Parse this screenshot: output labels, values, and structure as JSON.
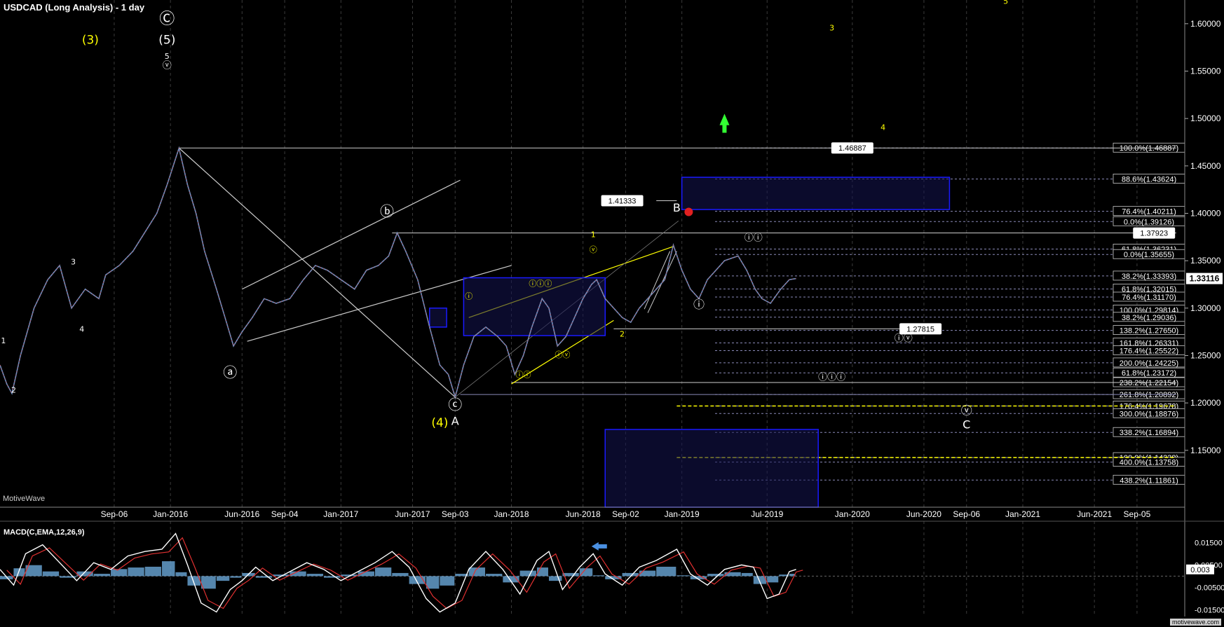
{
  "title": "USDCAD (Long  Analysis) - 1 day",
  "macd_title": "MACD(C,EMA,12,26,9)",
  "brand": "MotiveWave",
  "watermark": "motivewave.com",
  "colors": {
    "background": "#000000",
    "grid": "#3a3a3a",
    "axis": "#ffffff",
    "yellow": "#ffff00",
    "blue": "#1a1aff",
    "fib": "#8a8ab8",
    "macd_hist": "#6aa8d8",
    "macd_line": "#ffffff",
    "signal_line": "#e03030",
    "green": "#33ff33"
  },
  "chart_data": {
    "type": "line",
    "symbol": "USDCAD",
    "timeframe": "1 day",
    "x_axis": {
      "ticks": [
        "Sep-06",
        "Jan-2016",
        "Jun-2016",
        "Sep-04",
        "Jan-2017",
        "Jun-2017",
        "Sep-03",
        "Jan-2018",
        "Jun-2018",
        "Sep-02",
        "Jan-2019",
        "Jul-2019",
        "Jan-2020",
        "Jun-2020",
        "Sep-06",
        "Jan-2021",
        "Jun-2021",
        "Sep-05"
      ],
      "tick_pos": [
        2015.67,
        2016.0,
        2016.42,
        2016.67,
        2017.0,
        2017.42,
        2017.67,
        2018.0,
        2018.42,
        2018.67,
        2019.0,
        2019.5,
        2020.0,
        2020.42,
        2020.67,
        2021.0,
        2021.42,
        2021.67
      ],
      "xlim": [
        2015.0,
        2021.95
      ]
    },
    "y_axis": {
      "ticks": [
        "1.60000",
        "1.55000",
        "1.50000",
        "1.45000",
        "1.40000",
        "1.35000",
        "1.30000",
        "1.25000",
        "1.20000",
        "1.15000"
      ],
      "ylim": [
        1.09,
        1.625
      ]
    },
    "price_series": [
      [
        2015.0,
        1.24
      ],
      [
        2015.04,
        1.22
      ],
      [
        2015.07,
        1.21
      ],
      [
        2015.12,
        1.25
      ],
      [
        2015.2,
        1.3
      ],
      [
        2015.28,
        1.33
      ],
      [
        2015.35,
        1.345
      ],
      [
        2015.42,
        1.3
      ],
      [
        2015.5,
        1.32
      ],
      [
        2015.58,
        1.31
      ],
      [
        2015.62,
        1.335
      ],
      [
        2015.7,
        1.345
      ],
      [
        2015.78,
        1.36
      ],
      [
        2015.85,
        1.38
      ],
      [
        2015.92,
        1.4
      ],
      [
        2015.98,
        1.43
      ],
      [
        2016.05,
        1.4687
      ],
      [
        2016.1,
        1.43
      ],
      [
        2016.15,
        1.4
      ],
      [
        2016.2,
        1.36
      ],
      [
        2016.27,
        1.32
      ],
      [
        2016.32,
        1.29
      ],
      [
        2016.37,
        1.26
      ],
      [
        2016.42,
        1.275
      ],
      [
        2016.48,
        1.29
      ],
      [
        2016.55,
        1.31
      ],
      [
        2016.62,
        1.305
      ],
      [
        2016.7,
        1.31
      ],
      [
        2016.78,
        1.33
      ],
      [
        2016.85,
        1.345
      ],
      [
        2016.92,
        1.34
      ],
      [
        2017.0,
        1.33
      ],
      [
        2017.08,
        1.32
      ],
      [
        2017.15,
        1.34
      ],
      [
        2017.22,
        1.345
      ],
      [
        2017.28,
        1.355
      ],
      [
        2017.33,
        1.3793
      ],
      [
        2017.38,
        1.36
      ],
      [
        2017.45,
        1.33
      ],
      [
        2017.52,
        1.28
      ],
      [
        2017.58,
        1.24
      ],
      [
        2017.63,
        1.23
      ],
      [
        2017.67,
        1.2061
      ],
      [
        2017.72,
        1.24
      ],
      [
        2017.78,
        1.27
      ],
      [
        2017.85,
        1.28
      ],
      [
        2017.92,
        1.27
      ],
      [
        2017.97,
        1.26
      ],
      [
        2018.02,
        1.23
      ],
      [
        2018.07,
        1.25
      ],
      [
        2018.12,
        1.28
      ],
      [
        2018.18,
        1.31
      ],
      [
        2018.22,
        1.3
      ],
      [
        2018.27,
        1.26
      ],
      [
        2018.32,
        1.27
      ],
      [
        2018.37,
        1.29
      ],
      [
        2018.42,
        1.31
      ],
      [
        2018.47,
        1.325
      ],
      [
        2018.5,
        1.33
      ],
      [
        2018.55,
        1.31
      ],
      [
        2018.6,
        1.3
      ],
      [
        2018.65,
        1.29
      ],
      [
        2018.7,
        1.285
      ],
      [
        2018.75,
        1.3
      ],
      [
        2018.8,
        1.31
      ],
      [
        2018.85,
        1.32
      ],
      [
        2018.9,
        1.33
      ],
      [
        2018.95,
        1.3665
      ],
      [
        2019.0,
        1.34
      ],
      [
        2019.05,
        1.32
      ],
      [
        2019.1,
        1.31
      ],
      [
        2019.15,
        1.33
      ],
      [
        2019.2,
        1.34
      ],
      [
        2019.25,
        1.35
      ],
      [
        2019.33,
        1.355
      ],
      [
        2019.38,
        1.34
      ],
      [
        2019.43,
        1.32
      ],
      [
        2019.47,
        1.31
      ],
      [
        2019.52,
        1.305
      ],
      [
        2019.58,
        1.32
      ],
      [
        2019.63,
        1.33
      ],
      [
        2019.67,
        1.3312
      ]
    ],
    "annotations": [
      {
        "text": "(3)",
        "x": 2015.53,
        "y": 1.579,
        "color": "yellow",
        "size": 17
      },
      {
        "text": "Ⓒ",
        "x": 2015.98,
        "y": 1.6,
        "color": "white",
        "size": 22
      },
      {
        "text": "(5)",
        "x": 2015.98,
        "y": 1.579,
        "color": "white",
        "size": 17
      },
      {
        "text": "5",
        "x": 2015.98,
        "y": 1.563,
        "color": "white",
        "size": 11
      },
      {
        "text": "ⓥ",
        "x": 2015.98,
        "y": 1.553,
        "color": "white",
        "size": 13
      },
      {
        "text": "3",
        "x": 2015.43,
        "y": 1.346,
        "color": "white",
        "size": 11
      },
      {
        "text": "4",
        "x": 2015.48,
        "y": 1.275,
        "color": "white",
        "size": 11
      },
      {
        "text": "2",
        "x": 2015.08,
        "y": 1.211,
        "color": "white",
        "size": 11
      },
      {
        "text": "1",
        "x": 2015.02,
        "y": 1.263,
        "color": "white",
        "size": 11
      },
      {
        "text": "ⓐ",
        "x": 2016.35,
        "y": 1.227,
        "color": "white",
        "size": 20
      },
      {
        "text": "ⓑ",
        "x": 2017.27,
        "y": 1.397,
        "color": "white",
        "size": 20
      },
      {
        "text": "ⓒ",
        "x": 2017.67,
        "y": 1.193,
        "color": "white",
        "size": 20
      },
      {
        "text": "A",
        "x": 2017.67,
        "y": 1.177,
        "color": "white",
        "size": 16
      },
      {
        "text": "(4)",
        "x": 2017.58,
        "y": 1.175,
        "color": "yellow",
        "size": 17
      },
      {
        "text": "B",
        "x": 2018.97,
        "y": 1.402,
        "color": "white",
        "size": 16
      },
      {
        "text": "1",
        "x": 2018.48,
        "y": 1.375,
        "color": "yellow",
        "size": 11
      },
      {
        "text": "2",
        "x": 2018.65,
        "y": 1.27,
        "color": "yellow",
        "size": 11
      },
      {
        "text": "3",
        "x": 2019.88,
        "y": 1.593,
        "color": "yellow",
        "size": 11
      },
      {
        "text": "4",
        "x": 2020.18,
        "y": 1.488,
        "color": "yellow",
        "size": 11
      },
      {
        "text": "5",
        "x": 2020.9,
        "y": 1.621,
        "color": "yellow",
        "size": 11
      },
      {
        "text": "ⓘ",
        "x": 2019.1,
        "y": 1.3,
        "color": "white",
        "size": 16
      },
      {
        "text": "ⓘⓘ",
        "x": 2019.42,
        "y": 1.371,
        "color": "white",
        "size": 13
      },
      {
        "text": "ⓘⓘⓘ",
        "x": 2019.88,
        "y": 1.224,
        "color": "white",
        "size": 13
      },
      {
        "text": "ⓘⓥ",
        "x": 2020.3,
        "y": 1.265,
        "color": "white",
        "size": 13
      },
      {
        "text": "ⓥ",
        "x": 2020.67,
        "y": 1.188,
        "color": "white",
        "size": 16
      },
      {
        "text": "C",
        "x": 2020.67,
        "y": 1.173,
        "color": "white",
        "size": 16
      },
      {
        "text": "ⓘ",
        "x": 2017.75,
        "y": 1.31,
        "color": "yellow",
        "size": 11
      },
      {
        "text": "ⓘⓘ",
        "x": 2018.07,
        "y": 1.227,
        "color": "yellow",
        "size": 11
      },
      {
        "text": "ⓘⓘⓘ",
        "x": 2018.17,
        "y": 1.323,
        "color": "yellow",
        "size": 11
      },
      {
        "text": "ⓘⓥ",
        "x": 2018.3,
        "y": 1.248,
        "color": "yellow",
        "size": 11
      },
      {
        "text": "ⓥ",
        "x": 2018.48,
        "y": 1.359,
        "color": "yellow",
        "size": 11
      }
    ],
    "price_labels": [
      {
        "text": "1.46887",
        "x": 2020.0,
        "y": 1.4689
      },
      {
        "text": "1.41333",
        "x": 2018.65,
        "y": 1.4133
      },
      {
        "text": "1.37923",
        "x": 2021.77,
        "y": 1.3792
      },
      {
        "text": "1.27815",
        "x": 2020.4,
        "y": 1.2782
      }
    ],
    "current_price": "1.33116",
    "current_price_value": 1.3312,
    "fib_levels": [
      {
        "label": "100.0%(1.46887)",
        "value": 1.4689
      },
      {
        "label": "88.6%(1.43624)",
        "value": 1.4362
      },
      {
        "label": "76.4%(1.40211)",
        "value": 1.4021
      },
      {
        "label": "0.0%(1.39126)",
        "value": 1.3913
      },
      {
        "label": "61.8%(1.36231)",
        "value": 1.3623
      },
      {
        "label": "0.0%(1.35655)",
        "value": 1.3566
      },
      {
        "label": "38.2%(1.33393)",
        "value": 1.3339
      },
      {
        "label": "61.8%(1.32015)",
        "value": 1.3202
      },
      {
        "label": "76.4%(1.31170)",
        "value": 1.3117
      },
      {
        "label": "100.0%(1.29814)",
        "value": 1.2981
      },
      {
        "label": "38.2%(1.29036)",
        "value": 1.2904
      },
      {
        "label": "138.2%(1.27650)",
        "value": 1.2765
      },
      {
        "label": "161.8%(1.26331)",
        "value": 1.2633
      },
      {
        "label": "176.4%(1.25522)",
        "value": 1.2552
      },
      {
        "label": "200.0%(1.24225)",
        "value": 1.2423
      },
      {
        "label": "61.8%(1.23172)",
        "value": 1.2317
      },
      {
        "label": "238.2%(1.22154)",
        "value": 1.2215
      },
      {
        "label": "261.8%(1.20892)",
        "value": 1.2089
      },
      {
        "label": "176.4%(1.19678)",
        "value": 1.1968
      },
      {
        "label": "300.0%(1.18876)",
        "value": 1.1888
      },
      {
        "label": "338.2%(1.16894)",
        "value": 1.1689
      },
      {
        "label": "100.0%(1.14238)",
        "value": 1.1424
      },
      {
        "label": "400.0%(1.13758)",
        "value": 1.1376
      },
      {
        "label": "438.2%(1.11861)",
        "value": 1.1186
      }
    ],
    "macd": {
      "params": "12,26,9",
      "y_ticks": [
        "0.01500",
        "0.00500",
        "-0.00500",
        "-0.01500"
      ],
      "ylim": [
        -0.018,
        0.022
      ],
      "current_value": "0.003",
      "line": [
        [
          2015.0,
          0.003
        ],
        [
          2015.08,
          -0.004
        ],
        [
          2015.15,
          0.01
        ],
        [
          2015.25,
          0.014
        ],
        [
          2015.35,
          0.006
        ],
        [
          2015.45,
          -0.002
        ],
        [
          2015.55,
          0.006
        ],
        [
          2015.65,
          0.003
        ],
        [
          2015.75,
          0.009
        ],
        [
          2015.85,
          0.011
        ],
        [
          2015.95,
          0.012
        ],
        [
          2016.03,
          0.019
        ],
        [
          2016.1,
          0.005
        ],
        [
          2016.18,
          -0.012
        ],
        [
          2016.27,
          -0.016
        ],
        [
          2016.35,
          -0.006
        ],
        [
          2016.42,
          -0.002
        ],
        [
          2016.5,
          0.004
        ],
        [
          2016.6,
          -0.002
        ],
        [
          2016.7,
          0.002
        ],
        [
          2016.8,
          0.006
        ],
        [
          2016.9,
          0.003
        ],
        [
          2017.0,
          -0.002
        ],
        [
          2017.1,
          0.002
        ],
        [
          2017.2,
          0.006
        ],
        [
          2017.3,
          0.011
        ],
        [
          2017.4,
          0.004
        ],
        [
          2017.5,
          -0.01
        ],
        [
          2017.58,
          -0.016
        ],
        [
          2017.67,
          -0.012
        ],
        [
          2017.75,
          0.003
        ],
        [
          2017.85,
          0.011
        ],
        [
          2017.95,
          0.003
        ],
        [
          2018.05,
          -0.008
        ],
        [
          2018.15,
          0.007
        ],
        [
          2018.22,
          0.011
        ],
        [
          2018.3,
          -0.006
        ],
        [
          2018.4,
          0.004
        ],
        [
          2018.48,
          0.01
        ],
        [
          2018.55,
          0.001
        ],
        [
          2018.65,
          -0.004
        ],
        [
          2018.75,
          0.004
        ],
        [
          2018.85,
          0.007
        ],
        [
          2018.97,
          0.012
        ],
        [
          2019.05,
          0.001
        ],
        [
          2019.15,
          -0.004
        ],
        [
          2019.25,
          0.003
        ],
        [
          2019.35,
          0.005
        ],
        [
          2019.42,
          0.004
        ],
        [
          2019.5,
          -0.01
        ],
        [
          2019.57,
          -0.008
        ],
        [
          2019.63,
          0.002
        ],
        [
          2019.67,
          0.003
        ]
      ]
    }
  }
}
